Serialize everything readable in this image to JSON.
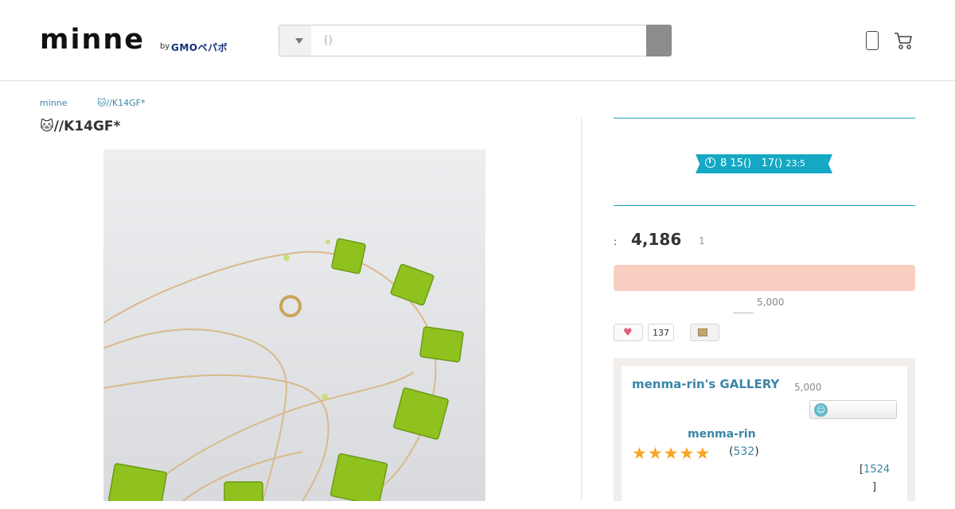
{
  "header": {
    "logo": "minne",
    "logo_by": "by",
    "logo_gmo": "GMOペパボ",
    "search_placeholder": "()",
    "icons": [
      "chevron-down-icon",
      "search-icon",
      "phone-icon",
      "cart-icon"
    ]
  },
  "breadcrumb": [
    "minne",
    "🐱//K14GF*"
  ],
  "product": {
    "title": "🐱//K14GF*",
    "sale_date": "8 15()",
    "sale_end": "17() ",
    "sale_time": "23:5",
    "price_label": ":",
    "price": "4,186",
    "stock": "1",
    "cart_button": "",
    "free_shipping": "5,000",
    "favorites_count": "137"
  },
  "shop": {
    "name": "menma-rin's GALLERY",
    "free_shipping": "5,000",
    "creator": "menma-rin",
    "rating": 5,
    "reviews_open": "(",
    "reviews": "532",
    "reviews_close": ")",
    "sales_open": "[",
    "sales": "1524",
    "sales_close": "]"
  },
  "colors": {
    "accent": "#14a8c4",
    "link": "#3a86a8",
    "cart_button": "#f9cfc2",
    "star": "#f5a623"
  }
}
